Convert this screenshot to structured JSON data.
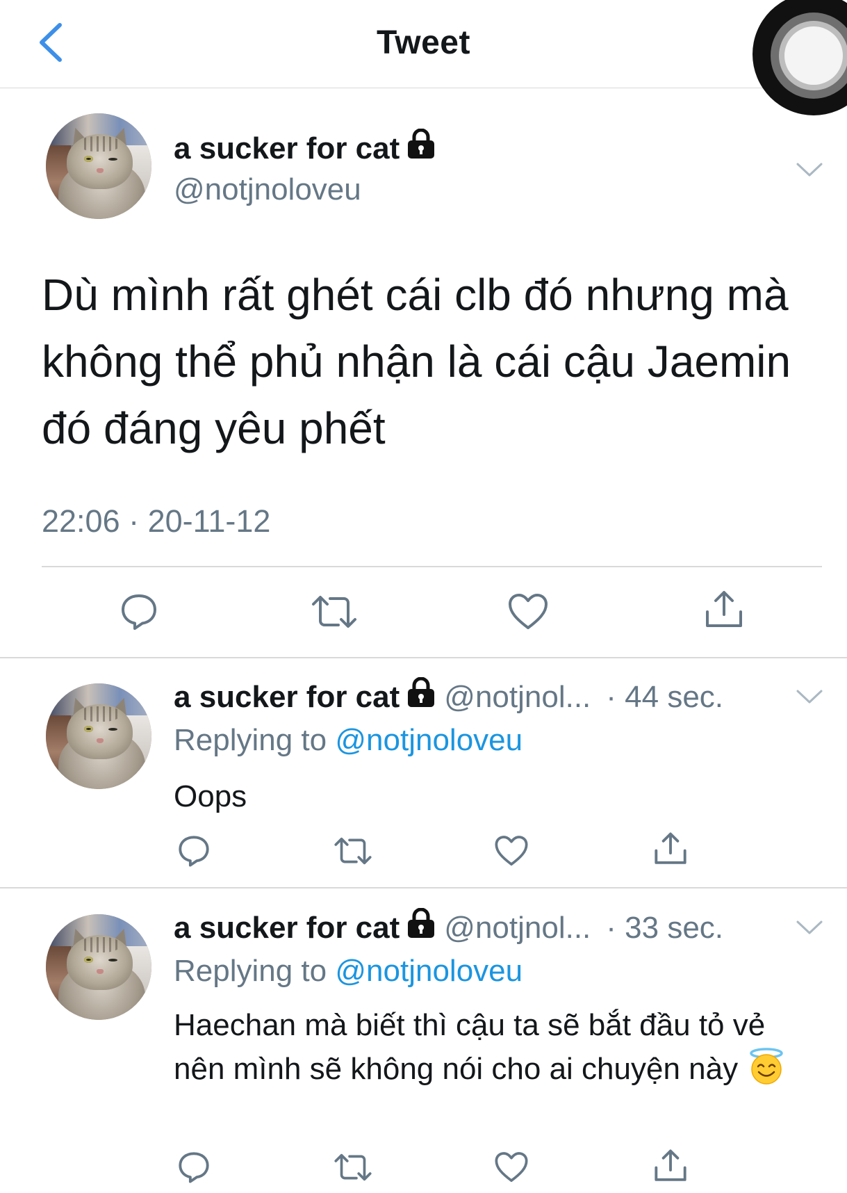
{
  "header": {
    "title": "Tweet",
    "back_icon": "chevron-left-icon"
  },
  "main_tweet": {
    "author_name": "a sucker for cat",
    "handle": "@notjnoloveu",
    "text": "Dù mình rất ghét cái clb đó nhưng mà không thể phủ nhận là cái cậu Jaemin đó đáng yêu phết",
    "timestamp": "22:06 · 20-11-12",
    "actions": [
      "reply-icon",
      "retweet-icon",
      "like-icon",
      "share-icon"
    ]
  },
  "replies": [
    {
      "author_name": "a sucker for cat",
      "handle": "@notjnol...",
      "time": "· 44 sec.",
      "replying_label": "Replying to",
      "replying_to": "@notjnoloveu",
      "text": "Oops"
    },
    {
      "author_name": "a sucker for cat",
      "handle": "@notjnol...",
      "time": "· 33 sec.",
      "replying_label": "Replying to",
      "replying_to": "@notjnoloveu",
      "text": "Haechan mà biết thì cậu ta sẽ bắt đầu tỏ vẻ nên mình sẽ không nói cho ai chuyện này",
      "emoji": "smiling-face-with-halo"
    }
  ],
  "colors": {
    "accent": "#1b95e0",
    "back_arrow": "#3d8fe8",
    "secondary_text": "#657786",
    "primary_text": "#14171a",
    "divider": "#d9d9d9"
  }
}
